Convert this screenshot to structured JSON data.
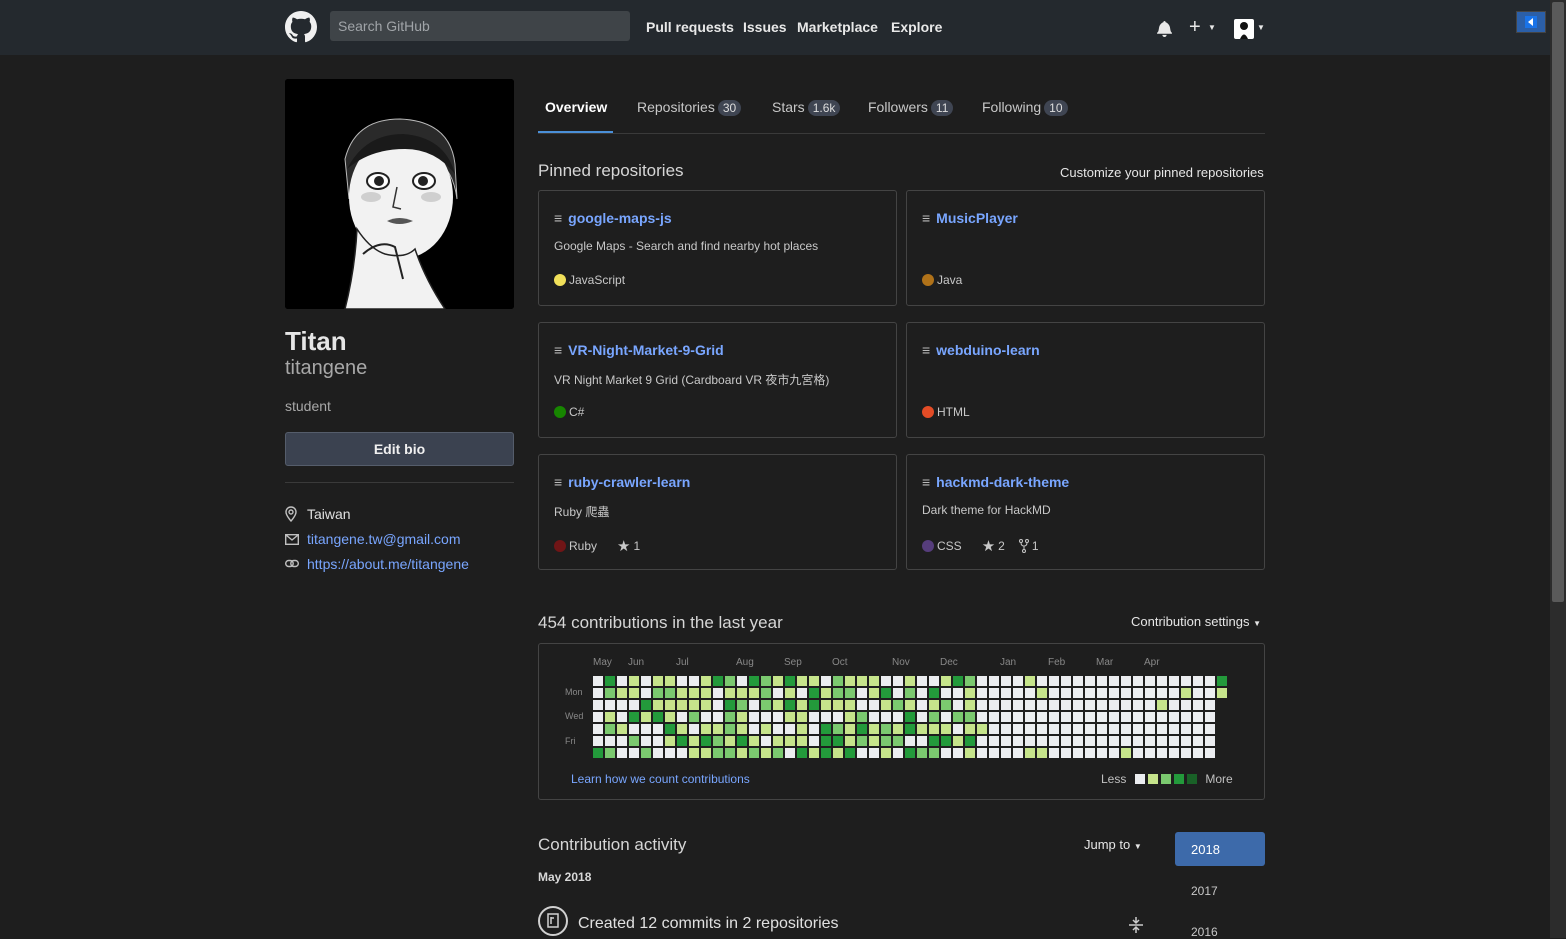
{
  "header": {
    "search_placeholder": "Search GitHub",
    "nav": [
      "Pull requests",
      "Issues",
      "Marketplace",
      "Explore"
    ]
  },
  "profile": {
    "name": "Titan",
    "username": "titangene",
    "bio": "student",
    "edit_bio_label": "Edit bio",
    "location": "Taiwan",
    "email": "titangene.tw@gmail.com",
    "website": "https://about.me/titangene"
  },
  "tabs": [
    {
      "label": "Overview",
      "count": ""
    },
    {
      "label": "Repositories",
      "count": "30"
    },
    {
      "label": "Stars",
      "count": "1.6k"
    },
    {
      "label": "Followers",
      "count": "11"
    },
    {
      "label": "Following",
      "count": "10"
    }
  ],
  "pinned": {
    "title": "Pinned repositories",
    "customize_label": "Customize your pinned repositories",
    "repos": [
      {
        "name": "google-maps-js",
        "desc": "Google Maps - Search and find nearby hot places",
        "lang": "JavaScript",
        "color": "#f1e05a",
        "stars": "",
        "forks": ""
      },
      {
        "name": "MusicPlayer",
        "desc": "",
        "lang": "Java",
        "color": "#b07219",
        "stars": "",
        "forks": ""
      },
      {
        "name": "VR-Night-Market-9-Grid",
        "desc": "VR Night Market 9 Grid (Cardboard VR 夜市九宮格)",
        "lang": "C#",
        "color": "#178600",
        "stars": "",
        "forks": ""
      },
      {
        "name": "webduino-learn",
        "desc": "",
        "lang": "HTML",
        "color": "#e34c26",
        "stars": "",
        "forks": ""
      },
      {
        "name": "ruby-crawler-learn",
        "desc": "Ruby 爬蟲",
        "lang": "Ruby",
        "color": "#701516",
        "stars": "1",
        "forks": ""
      },
      {
        "name": "hackmd-dark-theme",
        "desc": "Dark theme for HackMD",
        "lang": "CSS",
        "color": "#563d7c",
        "stars": "2",
        "forks": "1"
      }
    ]
  },
  "contributions": {
    "title": "454 contributions in the last year",
    "settings_label": "Contribution settings",
    "months": [
      "May",
      "Jun",
      "Jul",
      "Aug",
      "Sep",
      "Oct",
      "Nov",
      "Dec",
      "Jan",
      "Feb",
      "Mar",
      "Apr"
    ],
    "days": [
      "Mon",
      "Wed",
      "Fri"
    ],
    "learn_label": "Learn how we count contributions",
    "legend_less": "Less",
    "legend_more": "More",
    "level_colors": [
      "#ebedf0",
      "#c6e48b",
      "#7bc96f",
      "#239a3b",
      "#196127"
    ]
  },
  "activity": {
    "title": "Contribution activity",
    "jump_label": "Jump to",
    "years": [
      "2018",
      "2017",
      "2016"
    ],
    "month_label": "May 2018",
    "commits_summary": "Created 12 commits in 2 repositories"
  }
}
